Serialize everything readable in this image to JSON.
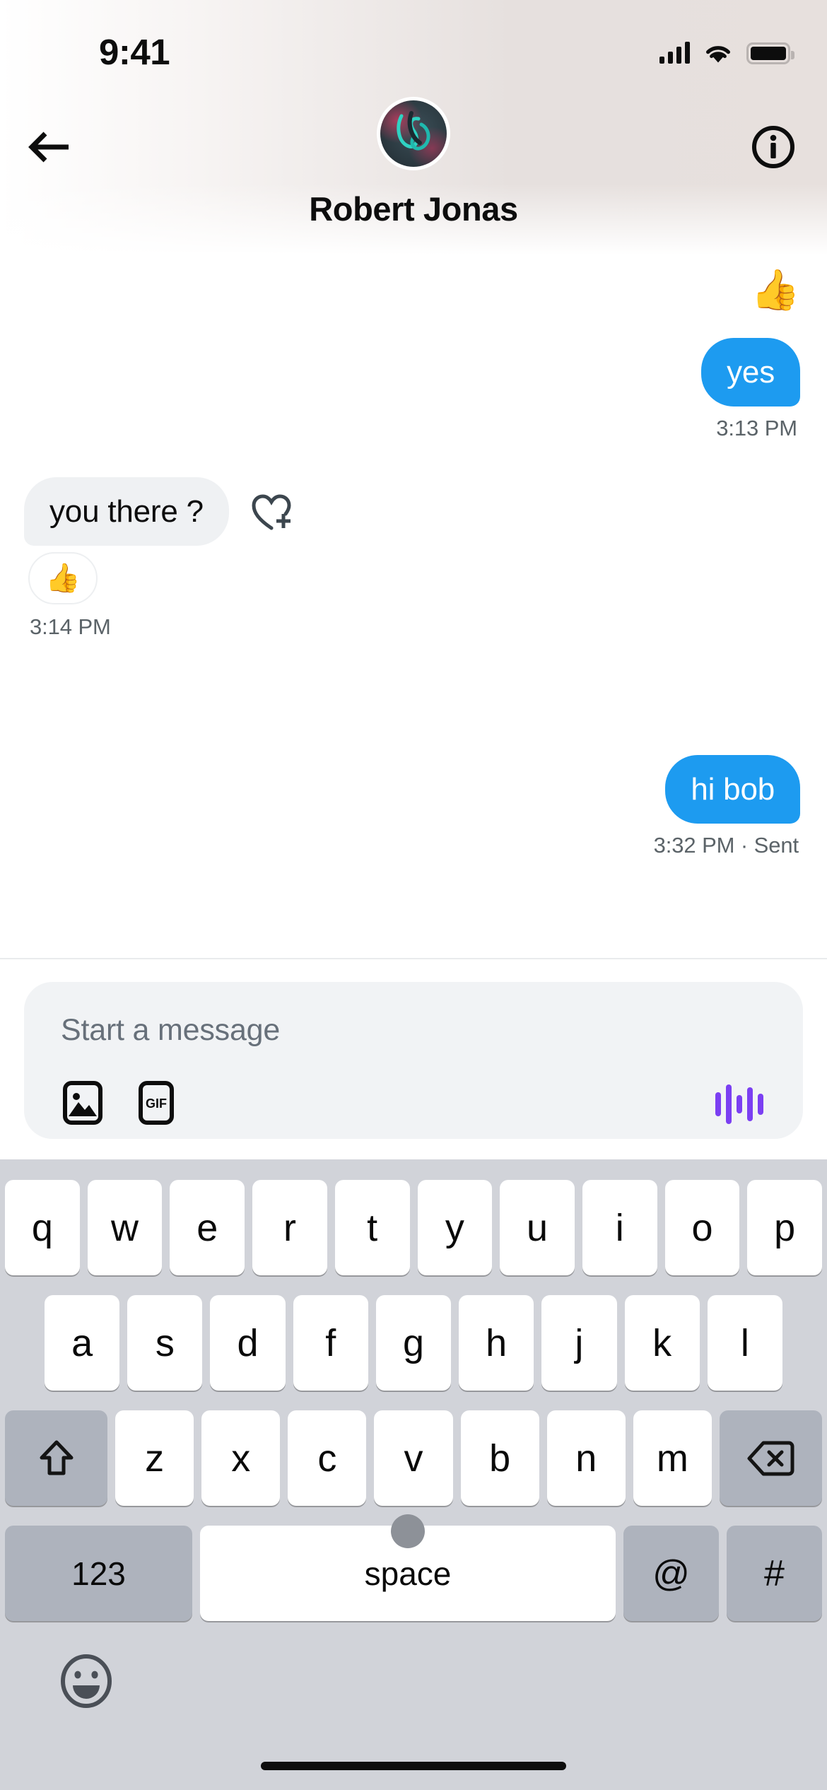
{
  "status_bar": {
    "time": "9:41",
    "signal_icon": "cellular-signal-icon",
    "wifi_icon": "wifi-icon",
    "battery_icon": "battery-full-icon",
    "signal_bars": 4
  },
  "header": {
    "back_icon": "back-arrow-icon",
    "info_icon": "info-circle-icon",
    "avatar_icon": "contact-avatar",
    "title": "Robert Jonas"
  },
  "conversation": {
    "floating_reaction": "👍",
    "messages": [
      {
        "id": "msg-yes",
        "direction": "outgoing",
        "text": "yes",
        "time": "3:13 PM",
        "status": ""
      },
      {
        "id": "msg-you-there",
        "direction": "incoming",
        "text": "you there ?",
        "time": "3:14 PM",
        "reaction": "👍",
        "add_reaction_icon": "heart-plus-icon"
      },
      {
        "id": "msg-hi-bob",
        "direction": "outgoing",
        "text": "hi bob",
        "time": "3:32 PM",
        "status": "· Sent"
      }
    ]
  },
  "composer": {
    "placeholder": "Start a message",
    "value": "",
    "image_icon": "photo-icon",
    "gif_icon": "gif-icon",
    "audio_icon": "audio-waveform-icon",
    "audio_color": "#7b3ff2"
  },
  "keyboard": {
    "row1": [
      "q",
      "w",
      "e",
      "r",
      "t",
      "y",
      "u",
      "i",
      "o",
      "p"
    ],
    "row2": [
      "a",
      "s",
      "d",
      "f",
      "g",
      "h",
      "j",
      "k",
      "l"
    ],
    "row3_letters": [
      "z",
      "x",
      "c",
      "v",
      "b",
      "n",
      "m"
    ],
    "shift_icon": "shift-arrow-icon",
    "backspace_icon": "backspace-icon",
    "numbers_key": "123",
    "space_key": "space",
    "at_key": "@",
    "hash_key": "#",
    "emoji_icon": "emoji-smiley-icon"
  },
  "theme": {
    "outgoing_bubble": "#1d9bf0",
    "incoming_bubble": "#eff1f3",
    "keyboard_bg": "#d1d3d9",
    "modifier_key": "#aeb3bd",
    "composer_bg": "#f1f3f5",
    "meta_text": "#5b6368"
  }
}
